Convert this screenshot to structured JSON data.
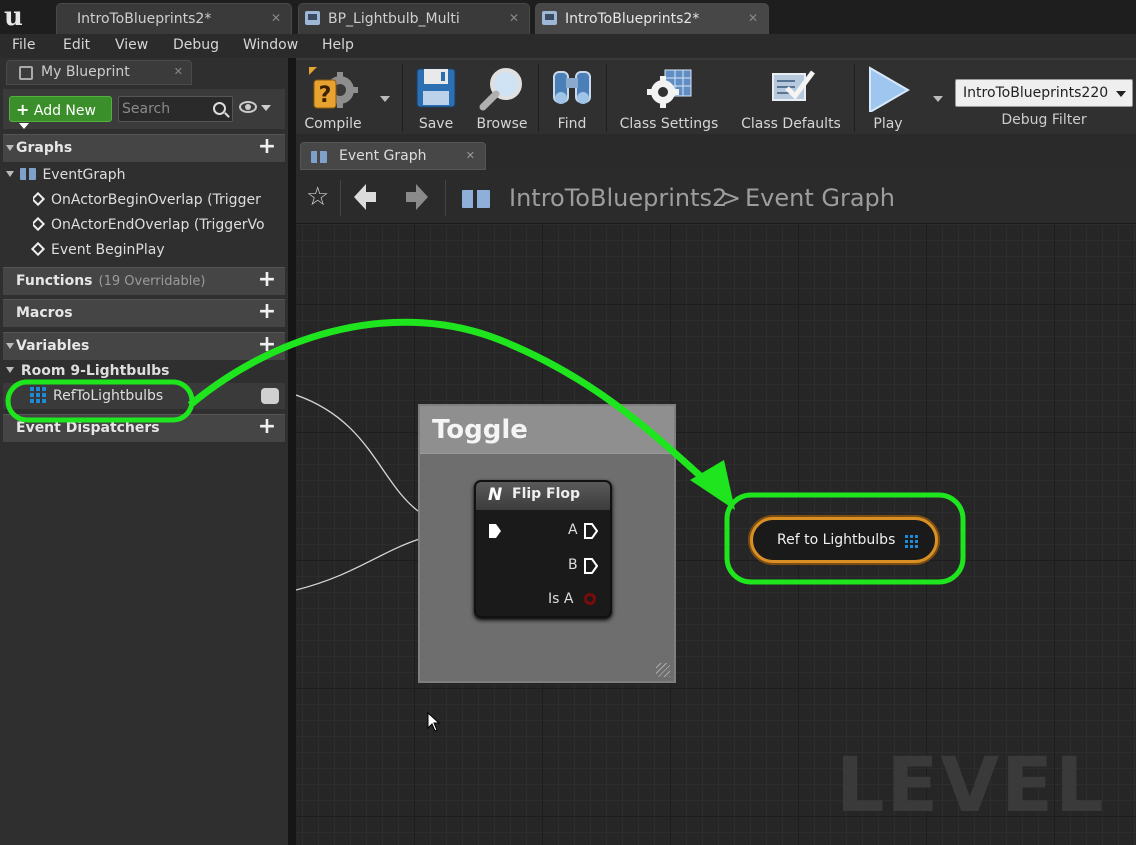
{
  "tabs": [
    {
      "label": "IntroToBlueprints2*",
      "active": false
    },
    {
      "label": "BP_Lightbulb_Multi",
      "active": false
    },
    {
      "label": "IntroToBlueprints2*",
      "active": true
    }
  ],
  "menu": [
    "File",
    "Edit",
    "View",
    "Debug",
    "Window",
    "Help"
  ],
  "my_blueprint": {
    "tab_label": "My Blueprint",
    "add_new_label": "Add New",
    "search_placeholder": "Search",
    "sections": {
      "graphs": "Graphs",
      "functions": "Functions",
      "functions_count": "(19 Overridable)",
      "macros": "Macros",
      "variables": "Variables",
      "event_dispatchers": "Event Dispatchers"
    },
    "graphs": {
      "event_graph": "EventGraph",
      "events": [
        "OnActorBeginOverlap (Trigger",
        "OnActorEndOverlap (TriggerVo",
        "Event BeginPlay"
      ]
    },
    "variable_category": "Room 9-Lightbulbs",
    "variable_name": "RefToLightbulbs"
  },
  "toolbar": {
    "compile": "Compile",
    "save": "Save",
    "browse": "Browse",
    "find": "Find",
    "class_settings": "Class Settings",
    "class_defaults": "Class Defaults",
    "play": "Play",
    "debug_filter_value": "IntroToBlueprints220",
    "debug_filter_label": "Debug Filter"
  },
  "graph_tab": "Event Graph",
  "breadcrumb": {
    "root": "IntroToBlueprints2",
    "separator": ">",
    "current": "Event Graph"
  },
  "comment_box": {
    "title": "Toggle"
  },
  "flipflop_node": {
    "title": "Flip Flop",
    "pins": [
      "A",
      "B",
      "Is A"
    ]
  },
  "variable_node": {
    "label": "Ref to Lightbulbs"
  },
  "watermark": "LEVEL BL",
  "colors": {
    "highlight": "#1ee51e",
    "var_node_border": "#d98f23",
    "accent_green": "#3a8f2a",
    "object_pin": "#1e8ad8"
  }
}
